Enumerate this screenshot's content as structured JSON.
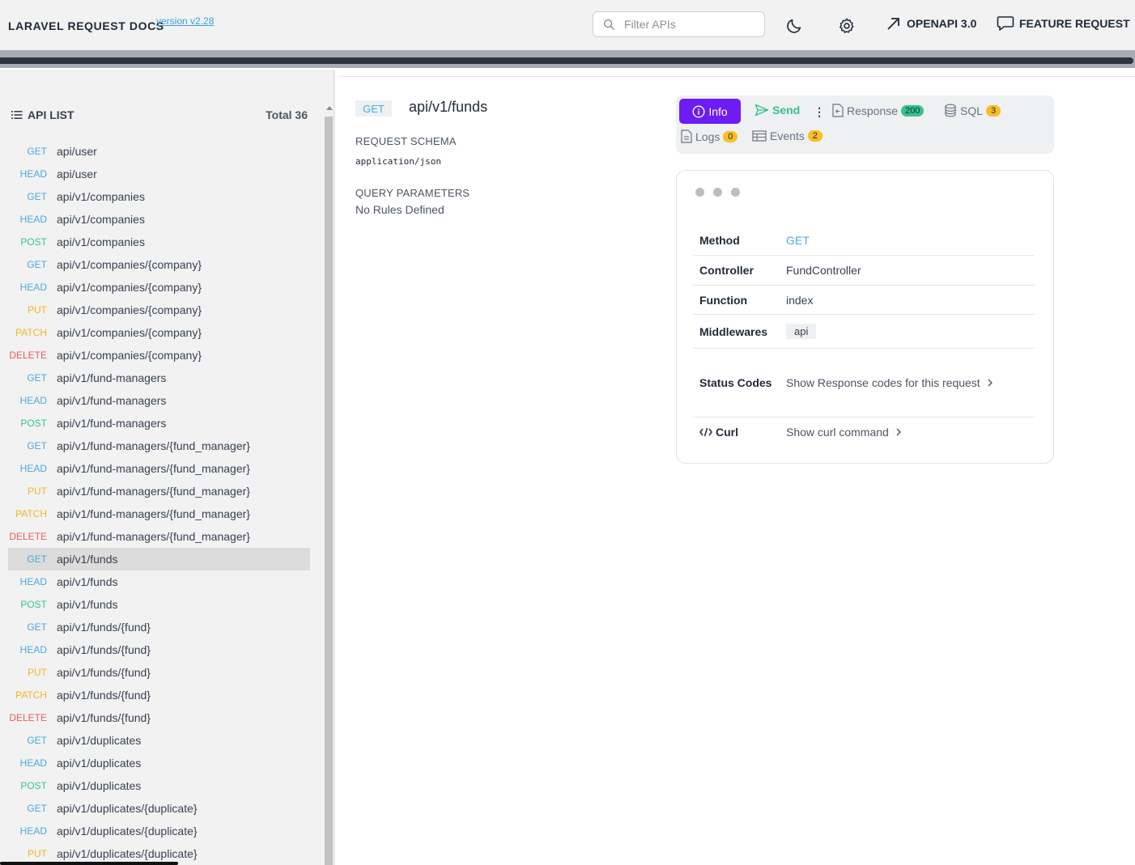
{
  "header": {
    "brand": "LARAVEL REQUEST DOCS",
    "version": "version v2.28",
    "search_placeholder": "Filter APIs",
    "openapi_label": "OPENAPI 3.0",
    "feature_label": "FEATURE REQUEST"
  },
  "sidebar": {
    "title": "API LIST",
    "total": "Total 36",
    "items": [
      {
        "method": "GET",
        "path": "api/user"
      },
      {
        "method": "HEAD",
        "path": "api/user"
      },
      {
        "method": "GET",
        "path": "api/v1/companies"
      },
      {
        "method": "HEAD",
        "path": "api/v1/companies"
      },
      {
        "method": "POST",
        "path": "api/v1/companies"
      },
      {
        "method": "GET",
        "path": "api/v1/companies/{company}"
      },
      {
        "method": "HEAD",
        "path": "api/v1/companies/{company}"
      },
      {
        "method": "PUT",
        "path": "api/v1/companies/{company}"
      },
      {
        "method": "PATCH",
        "path": "api/v1/companies/{company}"
      },
      {
        "method": "DELETE",
        "path": "api/v1/companies/{company}"
      },
      {
        "method": "GET",
        "path": "api/v1/fund-managers"
      },
      {
        "method": "HEAD",
        "path": "api/v1/fund-managers"
      },
      {
        "method": "POST",
        "path": "api/v1/fund-managers"
      },
      {
        "method": "GET",
        "path": "api/v1/fund-managers/{fund_manager}"
      },
      {
        "method": "HEAD",
        "path": "api/v1/fund-managers/{fund_manager}"
      },
      {
        "method": "PUT",
        "path": "api/v1/fund-managers/{fund_manager}"
      },
      {
        "method": "PATCH",
        "path": "api/v1/fund-managers/{fund_manager}"
      },
      {
        "method": "DELETE",
        "path": "api/v1/fund-managers/{fund_manager}"
      },
      {
        "method": "GET",
        "path": "api/v1/funds",
        "selected": true
      },
      {
        "method": "HEAD",
        "path": "api/v1/funds"
      },
      {
        "method": "POST",
        "path": "api/v1/funds"
      },
      {
        "method": "GET",
        "path": "api/v1/funds/{fund}"
      },
      {
        "method": "HEAD",
        "path": "api/v1/funds/{fund}"
      },
      {
        "method": "PUT",
        "path": "api/v1/funds/{fund}"
      },
      {
        "method": "PATCH",
        "path": "api/v1/funds/{fund}"
      },
      {
        "method": "DELETE",
        "path": "api/v1/funds/{fund}"
      },
      {
        "method": "GET",
        "path": "api/v1/duplicates"
      },
      {
        "method": "HEAD",
        "path": "api/v1/duplicates"
      },
      {
        "method": "POST",
        "path": "api/v1/duplicates"
      },
      {
        "method": "GET",
        "path": "api/v1/duplicates/{duplicate}"
      },
      {
        "method": "HEAD",
        "path": "api/v1/duplicates/{duplicate}"
      },
      {
        "method": "PUT",
        "path": "api/v1/duplicates/{duplicate}"
      }
    ]
  },
  "request": {
    "method": "GET",
    "path": "api/v1/funds",
    "schema_label": "REQUEST SCHEMA",
    "content_type": "application/json",
    "query_label": "QUERY PARAMETERS",
    "no_rules": "No Rules Defined"
  },
  "tabs": {
    "info": "Info",
    "send": "Send",
    "more": "⋮",
    "response": "Response",
    "response_badge": "200",
    "sql": "SQL",
    "sql_badge": "3",
    "logs": "Logs",
    "logs_badge": "0",
    "events": "Events",
    "events_badge": "2"
  },
  "info": {
    "method_label": "Method",
    "method_value": "GET",
    "controller_label": "Controller",
    "controller_value": "FundController",
    "function_label": "Function",
    "function_value": "index",
    "middlewares_label": "Middlewares",
    "middlewares": [
      "api"
    ],
    "status_label": "Status Codes",
    "status_link": "Show Response codes for this request",
    "curl_label": "Curl",
    "curl_link": "Show curl command"
  },
  "colors": {
    "accent": "#6d1cf4",
    "get": "#4aa8dd",
    "post": "#34c38f",
    "put": "#f3b622",
    "delete": "#ef5a5a"
  }
}
